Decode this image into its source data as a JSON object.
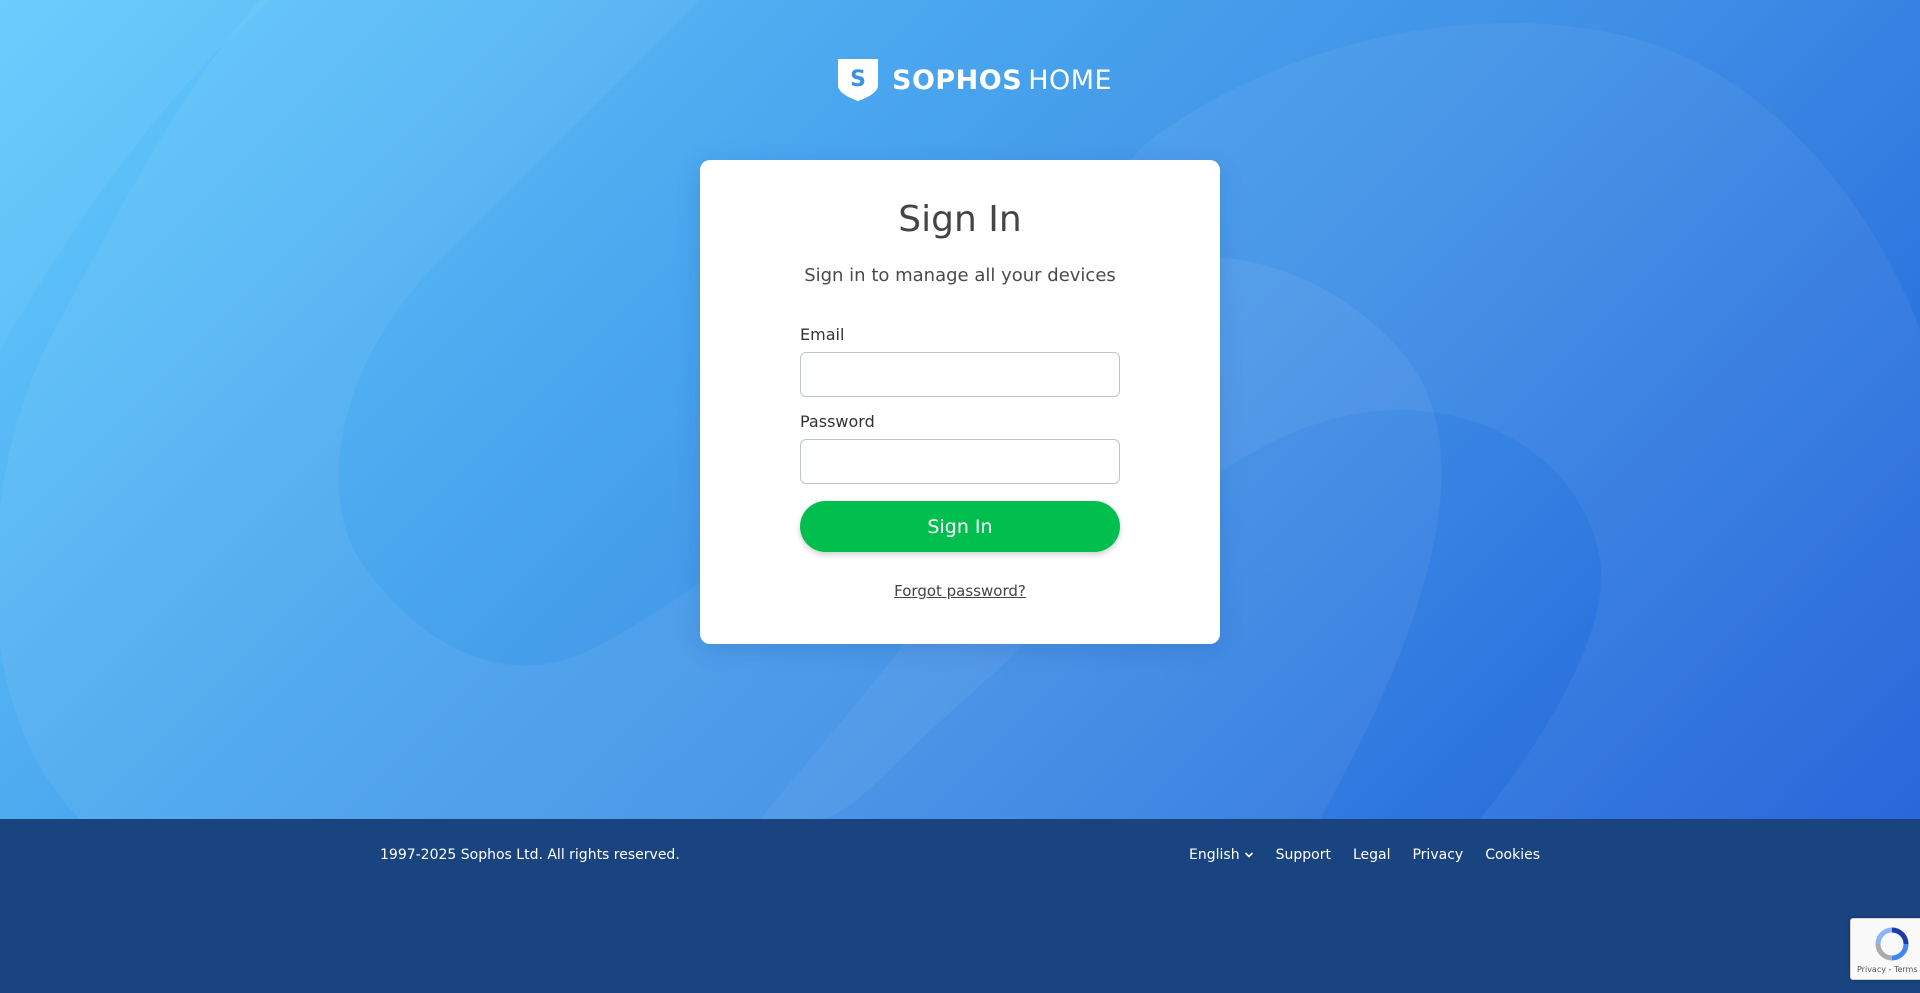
{
  "logo": {
    "brand": "SOPHOS",
    "product": "HOME",
    "shield_letter": "S"
  },
  "card": {
    "title": "Sign In",
    "subtitle": "Sign in to manage all your devices",
    "email_label": "Email",
    "email_value": "",
    "password_label": "Password",
    "password_value": "",
    "signin_button": "Sign In",
    "forgot_link": "Forgot password?"
  },
  "footer": {
    "copyright": "1997-2025 Sophos Ltd. All rights reserved.",
    "language": "English",
    "links": [
      "Support",
      "Legal",
      "Privacy",
      "Cookies"
    ]
  },
  "recaptcha": {
    "text": "Privacy - Terms"
  },
  "colors": {
    "primary_button": "#00bf4f",
    "footer_bg": "#1a4480",
    "hero_gradient_start": "#63cbfd",
    "hero_gradient_end": "#1f5fd9"
  },
  "icons": {
    "logo": "shield-icon",
    "language_toggle": "chevron-down-icon",
    "recaptcha": "recaptcha-icon"
  }
}
